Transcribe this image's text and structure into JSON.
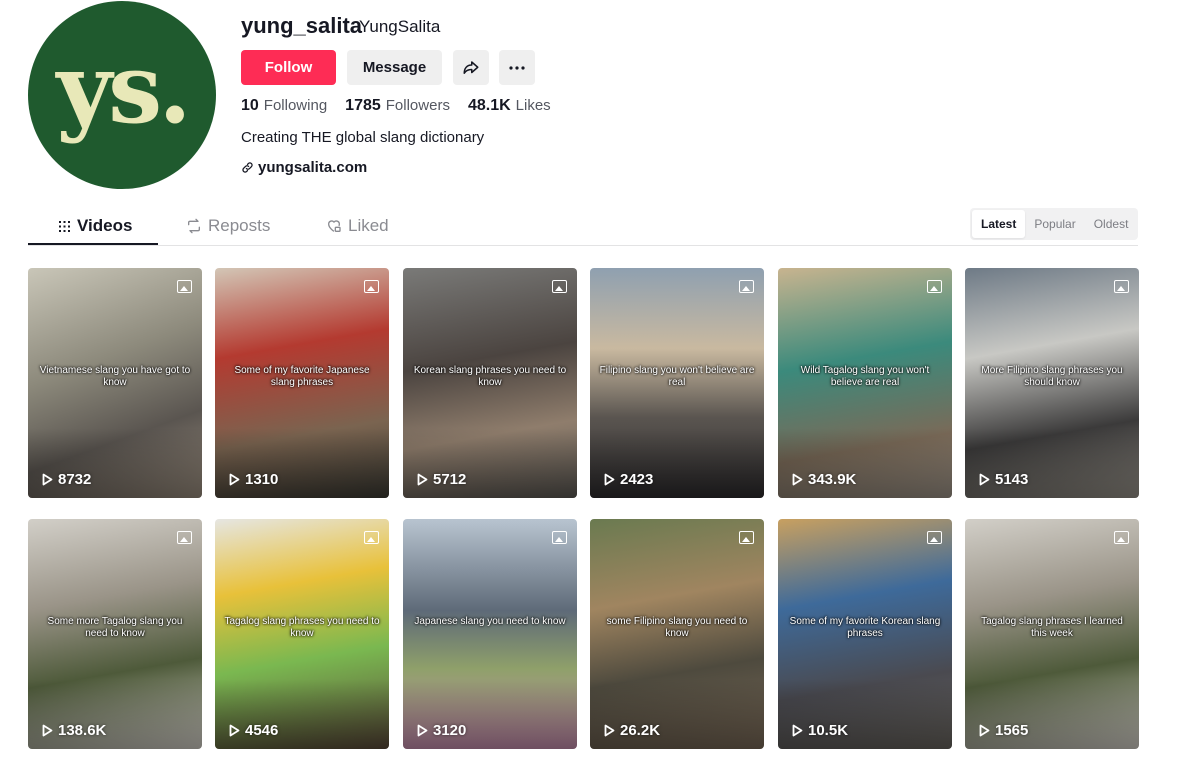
{
  "profile": {
    "avatar_text": "ys.",
    "username": "yung_salita",
    "nickname": "YungSalita",
    "follow_label": "Follow",
    "message_label": "Message",
    "following_count": "10",
    "following_label": "Following",
    "followers_count": "1785",
    "followers_label": "Followers",
    "likes_count": "48.1K",
    "likes_label": "Likes",
    "bio": "Creating THE global slang dictionary",
    "link": "yungsalita.com"
  },
  "tabs": {
    "videos": "Videos",
    "reposts": "Reposts",
    "liked": "Liked"
  },
  "sort": {
    "latest": "Latest",
    "popular": "Popular",
    "oldest": "Oldest"
  },
  "colors": {
    "accent": "#fe2c55",
    "avatar_bg": "#1f5a2e"
  },
  "videos": [
    {
      "caption": "Vietnamese slang you have got to know",
      "views": "8732",
      "bg": "linear-gradient(160deg,#c9c6b8 0%,#8d8a7c 40%,#5a5550 70%,#9c8f80 100%)"
    },
    {
      "caption": "Some of my favorite Japanese slang phrases",
      "views": "1310",
      "bg": "linear-gradient(170deg,#d3c6b6 0%,#b43a30 35%,#7a6450 70%,#3d3c35 100%)"
    },
    {
      "caption": "Korean slang phrases you need to know",
      "views": "5712",
      "bg": "linear-gradient(170deg,#7a7a78 0%,#4b4440 40%,#8f7d6c 70%,#5d5a55 100%)"
    },
    {
      "caption": "Filipino slang you won't believe are real",
      "views": "2423",
      "bg": "linear-gradient(180deg,#8fa0b0 0%,#c9b9a0 35%,#5a5550 65%,#2e2c2e 100%)"
    },
    {
      "caption": "Wild Tagalog slang you won't believe are real",
      "views": "343.9K",
      "bg": "linear-gradient(170deg,#c8b48f 0%,#3b8a7c 40%,#7a6a58 75%,#a0968a 100%)"
    },
    {
      "caption": "More Filipino slang phrases you should know",
      "views": "5143",
      "bg": "linear-gradient(170deg,#6e7a86 0%,#c8c8c4 35%,#3b3a3a 70%,#9a958c 100%)"
    },
    {
      "caption": "Some more Tagalog slang you need to know",
      "views": "138.6K",
      "bg": "linear-gradient(170deg,#d2cfc8 0%,#9a9488 35%,#4e5a3a 65%,#d8d4cc 100%)"
    },
    {
      "caption": "Tagalog slang phrases you need to know",
      "views": "4546",
      "bg": "linear-gradient(170deg,#e6e6e2 0%,#e8c13a 30%,#7ab850 60%,#5c4a3a 100%)"
    },
    {
      "caption": "Japanese slang you need to know",
      "views": "3120",
      "bg": "linear-gradient(180deg,#b8c4d0 0%,#5e6a78 40%,#8fa06a 65%,#c98fb0 100%)"
    },
    {
      "caption": "some Filipino slang you need to know",
      "views": "26.2K",
      "bg": "linear-gradient(170deg,#6a7a50 0%,#a08560 35%,#4e4a3e 65%,#7a6a58 100%)"
    },
    {
      "caption": "Some of my favorite Korean slang phrases",
      "views": "10.5K",
      "bg": "linear-gradient(170deg,#c8a060 0%,#3e6a9a 35%,#4a4a50 70%,#6a6660 100%)"
    },
    {
      "caption": "Tagalog slang phrases I learned this week",
      "views": "1565",
      "bg": "linear-gradient(170deg,#d2cfc8 0%,#9a9488 35%,#4e5a3a 65%,#d8d4cc 100%)"
    }
  ]
}
